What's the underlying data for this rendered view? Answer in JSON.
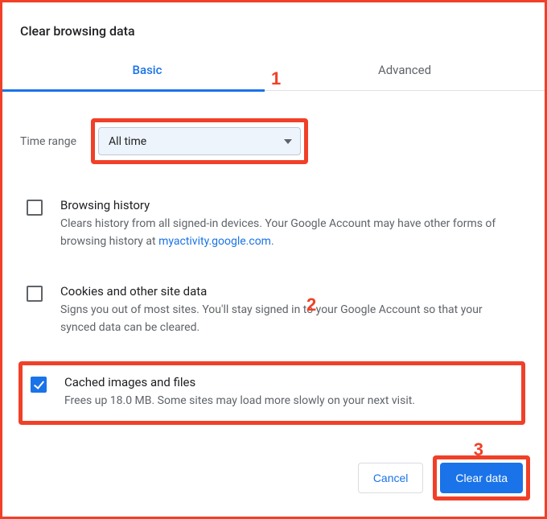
{
  "title": "Clear browsing data",
  "tabs": {
    "basic": "Basic",
    "advanced": "Advanced"
  },
  "timerange": {
    "label": "Time range",
    "value": "All time"
  },
  "options": {
    "history": {
      "title": "Browsing history",
      "desc_pre": "Clears history from all signed-in devices. Your Google Account may have other forms of browsing history at ",
      "link_text": "myactivity.google.com",
      "desc_post": ".",
      "checked": false
    },
    "cookies": {
      "title": "Cookies and other site data",
      "desc": "Signs you out of most sites. You'll stay signed in to your Google Account so that your synced data can be cleared.",
      "checked": false
    },
    "cache": {
      "title": "Cached images and files",
      "desc": "Frees up 18.0 MB. Some sites may load more slowly on your next visit.",
      "checked": true
    }
  },
  "buttons": {
    "cancel": "Cancel",
    "clear": "Clear data"
  },
  "annotations": {
    "a1": "1",
    "a2": "2",
    "a3": "3"
  }
}
